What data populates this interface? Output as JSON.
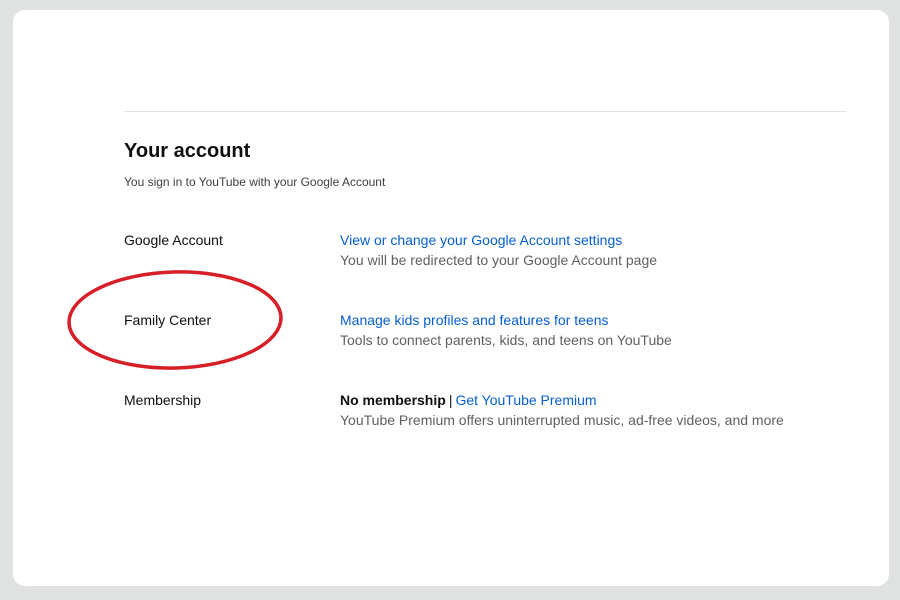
{
  "account": {
    "title": "Your account",
    "subtitle": "You sign in to YouTube with your Google Account"
  },
  "rows": [
    {
      "label": "Google Account",
      "link": "View or change your Google Account settings",
      "description": "You will be redirected to your Google Account page"
    },
    {
      "label": "Family Center",
      "link": "Manage kids profiles and features for teens",
      "description": "Tools to connect parents, kids, and teens on YouTube"
    },
    {
      "label": "Membership",
      "status": "No membership",
      "separator": "|",
      "link": "Get YouTube Premium",
      "description": "YouTube Premium offers uninterrupted music, ad-free videos, and more"
    }
  ],
  "colors": {
    "link": "#065fd4",
    "annotation": "#d61f26",
    "background": "#dfe2e1"
  }
}
